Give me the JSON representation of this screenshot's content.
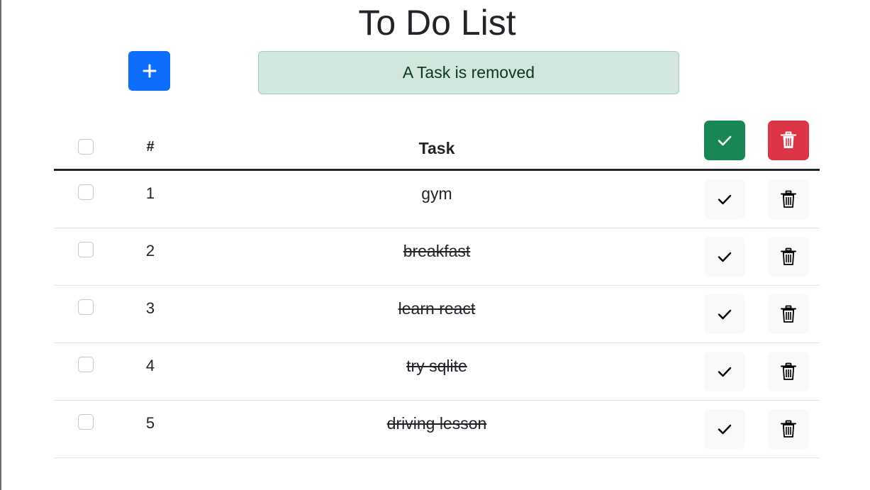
{
  "header": {
    "title": "To Do List",
    "add_button_icon": "plus-icon"
  },
  "alert": {
    "message": "A Task is removed"
  },
  "table": {
    "columns": {
      "number": "#",
      "task": "Task"
    },
    "bulk_actions": {
      "complete_icon": "check-icon",
      "delete_icon": "trash-icon"
    },
    "rows": [
      {
        "number": "1",
        "task": "gym",
        "completed": false
      },
      {
        "number": "2",
        "task": "breakfast",
        "completed": true
      },
      {
        "number": "3",
        "task": "learn react",
        "completed": true
      },
      {
        "number": "4",
        "task": "try sqlite",
        "completed": true
      },
      {
        "number": "5",
        "task": "driving lesson",
        "completed": true
      }
    ]
  },
  "colors": {
    "primary": "#0d6efd",
    "success": "#198754",
    "danger": "#dc3545",
    "alert_bg": "#d1e7dd",
    "alert_text": "#0a3622"
  }
}
